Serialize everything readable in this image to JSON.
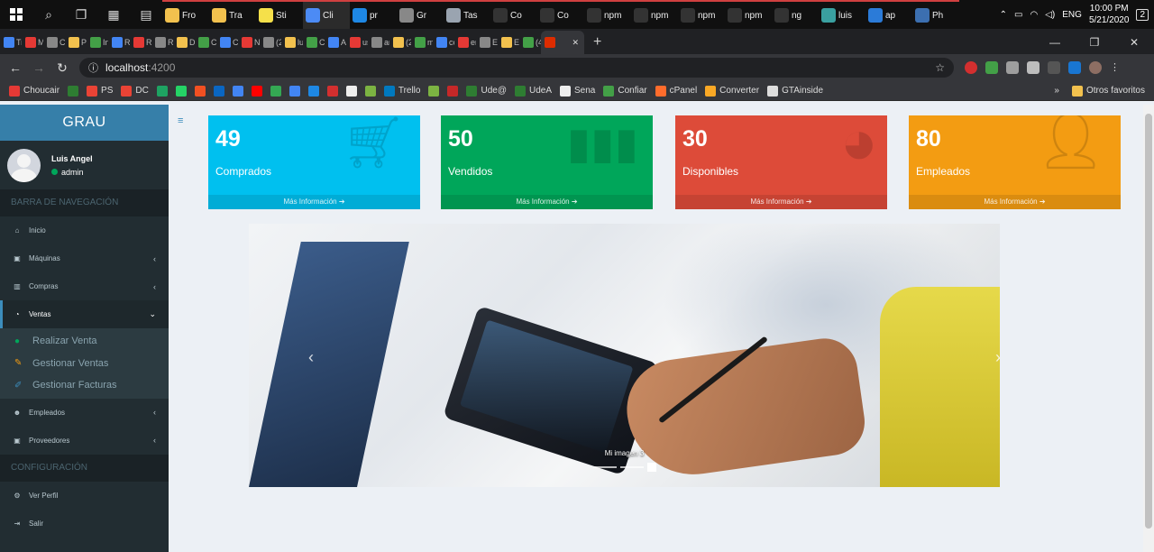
{
  "taskbar": {
    "apps": [
      {
        "label": "Fro",
        "color": "#f2c14e"
      },
      {
        "label": "Tra",
        "color": "#f2c14e"
      },
      {
        "label": "Sti",
        "color": "#f5e04a"
      },
      {
        "label": "Cli",
        "color": "#4c8bf5"
      },
      {
        "label": "pr",
        "color": "#1e88e5"
      },
      {
        "label": "Gr",
        "color": "#888888"
      },
      {
        "label": "Tas",
        "color": "#9aa4b0"
      },
      {
        "label": "Co",
        "color": "#333333"
      },
      {
        "label": "Co",
        "color": "#333333"
      },
      {
        "label": "npm",
        "color": "#333333"
      },
      {
        "label": "npm",
        "color": "#333333"
      },
      {
        "label": "npm",
        "color": "#333333"
      },
      {
        "label": "npm",
        "color": "#333333"
      },
      {
        "label": "ng",
        "color": "#333333"
      },
      {
        "label": "luis",
        "color": "#3aa0a0"
      },
      {
        "label": "ap",
        "color": "#2b7bd8"
      },
      {
        "label": "Ph",
        "color": "#3c6fb0"
      }
    ],
    "tray_lang": "ENG",
    "time": "10:00 PM",
    "date": "5/21/2020",
    "notifications": "2"
  },
  "browser": {
    "tabs": [
      "Tr",
      "Mi",
      "Cc",
      "Pr",
      "Ins",
      "Re",
      "Re",
      "Re",
      "Dc",
      "Cc",
      "Cu",
      "Nc",
      "(2",
      "lui",
      "Cl",
      "Ac",
      "us",
      "an",
      "(2",
      "m",
      "cc",
      "er",
      "Er",
      "Er",
      "(4",
      ""
    ],
    "url_host": "localhost",
    "url_port": ":4200",
    "bookmarks": [
      {
        "label": "Choucair",
        "color": "#e53935"
      },
      {
        "label": "",
        "color": "#2e7d32"
      },
      {
        "label": "PS",
        "color": "#ea4335"
      },
      {
        "label": "DC",
        "color": "#ea4335"
      },
      {
        "label": "",
        "color": "#1ea362"
      },
      {
        "label": "",
        "color": "#25d366"
      },
      {
        "label": "",
        "color": "#f25022"
      },
      {
        "label": "",
        "color": "#0a66c2"
      },
      {
        "label": "",
        "color": "#4285f4"
      },
      {
        "label": "",
        "color": "#ff0000"
      },
      {
        "label": "",
        "color": "#34a853"
      },
      {
        "label": "",
        "color": "#4285f4"
      },
      {
        "label": "",
        "color": "#1e88e5"
      },
      {
        "label": "",
        "color": "#d32f2f"
      },
      {
        "label": "",
        "color": "#eeeeee"
      },
      {
        "label": "",
        "color": "#7cb342"
      },
      {
        "label": "Trello",
        "color": "#0079bf"
      },
      {
        "label": "",
        "color": "#7cb342"
      },
      {
        "label": "",
        "color": "#c62828"
      },
      {
        "label": "Ude@",
        "color": "#2e7d32"
      },
      {
        "label": "UdeA",
        "color": "#2e7d32"
      },
      {
        "label": "Sena",
        "color": "#eeeeee"
      },
      {
        "label": "Confiar",
        "color": "#43a047"
      },
      {
        "label": "cPanel",
        "color": "#ff6c2c"
      },
      {
        "label": "Converter",
        "color": "#f9a825"
      },
      {
        "label": "GTAinside",
        "color": "#dddddd"
      }
    ],
    "more": "»",
    "other_bookmarks": "Otros favoritos"
  },
  "sidebar": {
    "brand": "GRAU",
    "user_name": "Luis Angel",
    "user_role": "admin",
    "nav_header": "BARRA DE NAVEGACIÓN",
    "config_header": "CONFIGURACIÓN",
    "items": [
      {
        "label": "Inicio",
        "icon": "home-icon"
      },
      {
        "label": "Máquinas",
        "icon": "machine-icon"
      },
      {
        "label": "Compras",
        "icon": "chart-icon"
      },
      {
        "label": "Ventas",
        "icon": "pie-icon"
      },
      {
        "label": "Empleados",
        "icon": "users-icon"
      },
      {
        "label": "Proveedores",
        "icon": "supplier-icon"
      },
      {
        "label": "Ver Perfil",
        "icon": "gear-icon"
      },
      {
        "label": "Salir",
        "icon": "logout-icon"
      }
    ],
    "ventas_sub": [
      {
        "label": "Realizar Venta",
        "color": "#00a65a"
      },
      {
        "label": "Gestionar Ventas",
        "color": "#f39c12"
      },
      {
        "label": "Gestionar Facturas",
        "color": "#3c8dbc"
      }
    ]
  },
  "stats": [
    {
      "value": "49",
      "label": "Comprados",
      "color": "#00c0ef",
      "icon": "cart-icon"
    },
    {
      "value": "50",
      "label": "Vendidos",
      "color": "#00a65a",
      "icon": "bar-chart-icon"
    },
    {
      "value": "30",
      "label": "Disponibles",
      "color": "#dd4b39",
      "icon": "pie-chart-icon"
    },
    {
      "value": "80",
      "label": "Empleados",
      "color": "#f39c12",
      "icon": "person-icon"
    }
  ],
  "stats_more": "Más Información ➔",
  "carousel": {
    "caption": "Mi imagen 3",
    "slide_count": 3,
    "active_slide": 3,
    "prev": "‹",
    "next": "›"
  }
}
